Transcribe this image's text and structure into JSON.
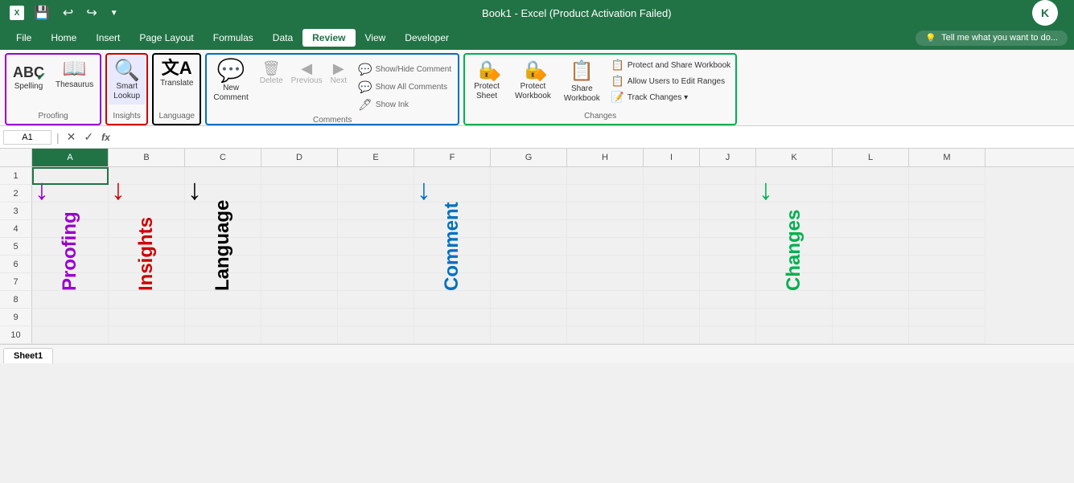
{
  "titleBar": {
    "title": "Book1 - Excel (Product Activation Failed)",
    "saveIcon": "💾",
    "undoIcon": "↩",
    "redoIcon": "↪",
    "customizeIcon": "▼"
  },
  "menuBar": {
    "items": [
      "File",
      "Home",
      "Insert",
      "Page Layout",
      "Formulas",
      "Data",
      "Review",
      "View",
      "Developer"
    ],
    "activeItem": "Review",
    "tellMePlaceholder": "Tell me what you want to do..."
  },
  "ribbon": {
    "groups": [
      {
        "id": "proofing",
        "label": "Proofing",
        "outline": "purple",
        "items": [
          {
            "icon": "✔",
            "label": "Spelling",
            "sublabel": ""
          },
          {
            "icon": "📖",
            "label": "Thesaurus",
            "sublabel": ""
          }
        ]
      },
      {
        "id": "insights",
        "label": "Insights",
        "outline": "red",
        "items": [
          {
            "icon": "🔍",
            "label": "Smart",
            "sublabel": "Lookup"
          }
        ]
      },
      {
        "id": "language",
        "label": "Language",
        "outline": "black",
        "items": [
          {
            "icon": "文A",
            "label": "Translate",
            "sublabel": ""
          }
        ]
      },
      {
        "id": "comments",
        "label": "Comments",
        "outline": "blue",
        "items_big": [
          {
            "icon": "💬",
            "label": "New\nComment"
          }
        ],
        "items_small_disabled": [
          "Delete",
          "Previous",
          "Next"
        ],
        "items_right": [
          {
            "icon": "💬",
            "label": "Show/Hide Comment"
          },
          {
            "icon": "💬",
            "label": "Show All Comments"
          },
          {
            "icon": "🖊",
            "label": "Show Ink"
          }
        ]
      },
      {
        "id": "changes",
        "label": "Changes",
        "outline": "green",
        "protect_sheet": {
          "icon": "🔒",
          "label": "Protect\nSheet"
        },
        "protect_workbook": {
          "icon": "🔒",
          "label": "Protect\nWorkbook"
        },
        "share_workbook": {
          "icon": "📋",
          "label": "Share\nWorkbook"
        },
        "right_items": [
          {
            "icon": "📋",
            "label": "Protect and Share Workbook"
          },
          {
            "icon": "📋",
            "label": "Allow Users to Edit Ranges"
          },
          {
            "icon": "📝",
            "label": "Track Changes ▾"
          }
        ]
      }
    ]
  },
  "formulaBar": {
    "cellRef": "A1",
    "formula": ""
  },
  "spreadsheet": {
    "columns": [
      "A",
      "B",
      "C",
      "D",
      "E",
      "F",
      "G",
      "H",
      "I",
      "J",
      "K",
      "L",
      "M"
    ],
    "rows": 10,
    "selectedCell": "A1",
    "annotations": [
      {
        "col": "A",
        "colIndex": 0,
        "arrowColor": "#9900cc",
        "text": "Proofing",
        "textColor": "#9900cc",
        "startRow": 2,
        "endRow": 7
      },
      {
        "col": "B",
        "colIndex": 1,
        "arrowColor": "#cc0000",
        "text": "Insights",
        "textColor": "#cc0000",
        "startRow": 2,
        "endRow": 7
      },
      {
        "col": "C",
        "colIndex": 2,
        "arrowColor": "#000000",
        "text": "Language",
        "textColor": "#000000",
        "startRow": 2,
        "endRow": 7
      },
      {
        "col": "F",
        "colIndex": 5,
        "arrowColor": "#0070c0",
        "text": "Comment",
        "textColor": "#0070c0",
        "startRow": 2,
        "endRow": 7
      },
      {
        "col": "K",
        "colIndex": 10,
        "arrowColor": "#00b050",
        "text": "Changes",
        "textColor": "#00b050",
        "startRow": 2,
        "endRow": 7
      }
    ]
  },
  "sheetTabs": [
    "Sheet1"
  ],
  "activeSheet": "Sheet1"
}
